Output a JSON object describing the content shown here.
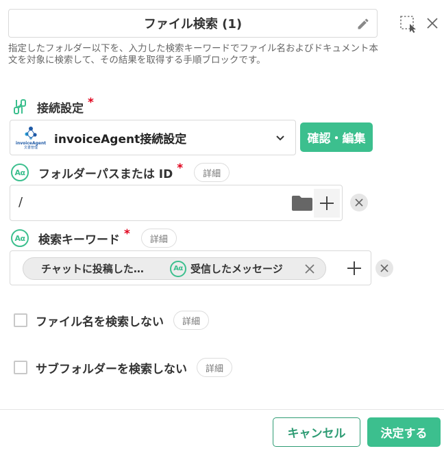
{
  "header": {
    "title": "ファイル検索 (1)",
    "edit_icon": "pencil-icon",
    "select_icon": "select-area-icon",
    "close_icon": "close-icon"
  },
  "description": "指定したフォルダー以下を、入力した検索キーワードでファイル名およびドキュメント本文を対象に検索して、その結果を取得する手順ブロックです。",
  "connection": {
    "label": "接続設定",
    "required_mark": "*",
    "selected": "invoiceAgent接続設定",
    "logo_text": "invoiceAgent",
    "logo_subtext": "文書管理",
    "confirm_button": "確認・編集"
  },
  "folder_path": {
    "icon_text": "Aα",
    "label": "フォルダーパスまたは ID",
    "required_mark": "*",
    "detail": "詳細",
    "value": "/"
  },
  "keyword": {
    "icon_text": "Aα",
    "label": "検索キーワード",
    "required_mark": "*",
    "detail": "詳細",
    "chip_first": "チャットに投稿した…",
    "chip_icon_text": "Aα",
    "chip_second": "受信したメッセージ"
  },
  "options": {
    "no_filename": {
      "label": "ファイル名を検索しない",
      "detail": "詳細",
      "checked": false
    },
    "no_subfolder": {
      "label": "サブフォルダーを検索しない",
      "detail": "詳細",
      "checked": false
    }
  },
  "footer": {
    "cancel": "キャンセル",
    "ok": "決定する"
  },
  "colors": {
    "accent": "#3cbf8e",
    "accent_dark": "#2d9b73",
    "required": "#e0001b"
  }
}
